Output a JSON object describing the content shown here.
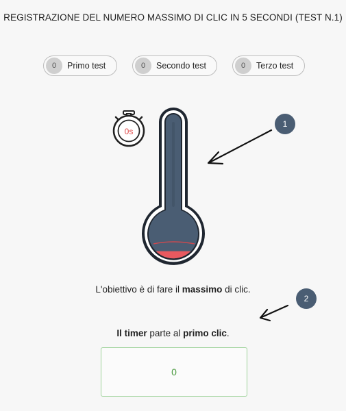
{
  "title": "REGISTRAZIONE DEL NUMERO MASSIMO DI CLIC IN 5 SECONDI (TEST N.1)",
  "tests": [
    {
      "count": "0",
      "label": "Primo test"
    },
    {
      "count": "0",
      "label": "Secondo test"
    },
    {
      "count": "0",
      "label": "Terzo test"
    }
  ],
  "stopwatch": {
    "label": "0s",
    "icon": "stopwatch-icon"
  },
  "thermometer": {
    "icon": "thermometer-icon",
    "fill_level": 0.05,
    "fill_color": "#e8595f",
    "tube_color": "#4a5d73"
  },
  "badges": {
    "first": "1",
    "second": "2"
  },
  "goal": {
    "prefix": "L'obiettivo è di fare il ",
    "bold": "massimo",
    "suffix": " di clic."
  },
  "timer_note": {
    "bold1": "Il timer",
    "middle": " parte al ",
    "bold2": "primo clic",
    "suffix": "."
  },
  "click_counter": "0",
  "colors": {
    "accent": "#4a5d73",
    "counter": "#4a9a3f",
    "counter_border": "#9ed39a"
  }
}
